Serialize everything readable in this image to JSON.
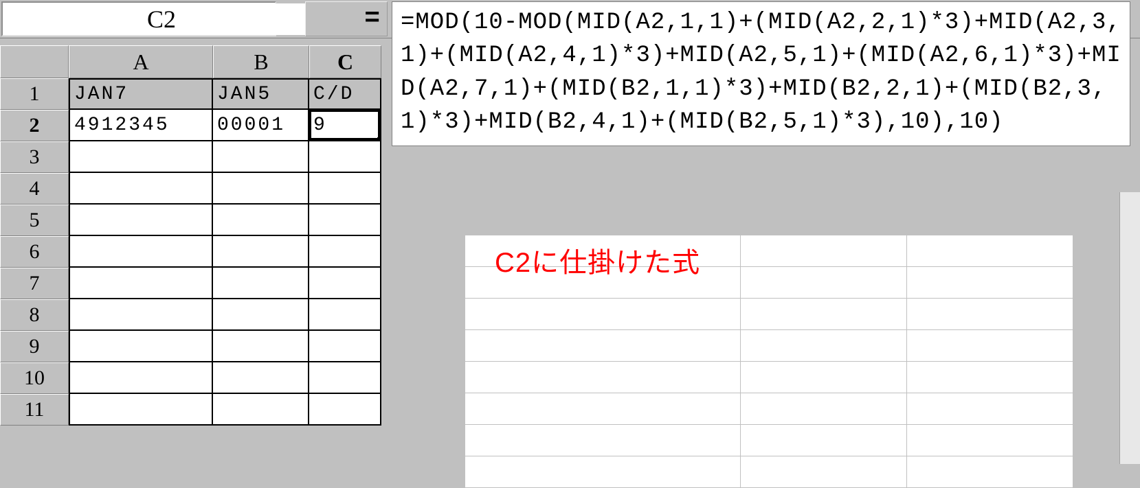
{
  "formula_bar": {
    "name_box_value": "C2",
    "equals_label": "=",
    "formula_text": "=MOD(10-MOD(MID(A2,1,1)+(MID(A2,2,1)*3)+MID(A2,3,1)+(MID(A2,4,1)*3)+MID(A2,5,1)+(MID(A2,6,1)*3)+MID(A2,7,1)+(MID(B2,1,1)*3)+MID(B2,2,1)+(MID(B2,3,1)*3)+MID(B2,4,1)+(MID(B2,5,1)*3),10),10)"
  },
  "columns": {
    "A": "A",
    "B": "B",
    "C": "C"
  },
  "row_labels": [
    "1",
    "2",
    "3",
    "4",
    "5",
    "6",
    "7",
    "8",
    "9",
    "10",
    "11"
  ],
  "cells": {
    "r1": {
      "A": "JAN7",
      "B": "JAN5",
      "C": "C/D"
    },
    "r2": {
      "A": "4912345",
      "B": "00001",
      "C": "9"
    }
  },
  "annotation": "C2に仕掛けた式",
  "active_cell": "C2"
}
